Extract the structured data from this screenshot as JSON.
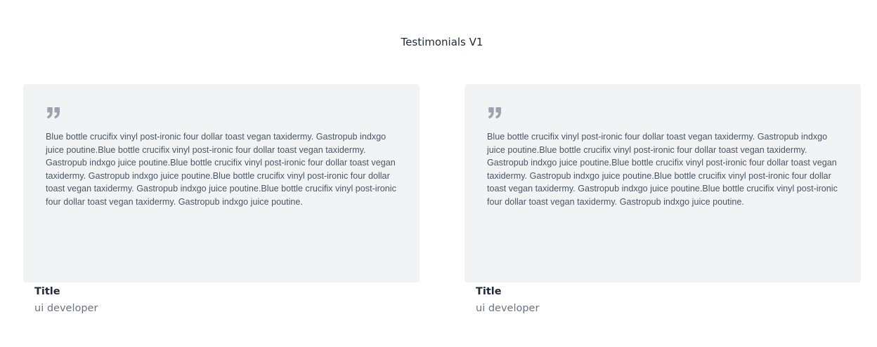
{
  "header": {
    "title": "Testimonials V1"
  },
  "colors": {
    "card_background": "#f1f3f5",
    "quote_icon": "#9ca3af",
    "text": "#4b5563",
    "title": "#1f2937",
    "subtitle": "#6b7280"
  },
  "testimonials": [
    {
      "icon": "quote-icon",
      "text": "Blue bottle crucifix vinyl post-ironic four dollar toast vegan taxidermy. Gastropub indxgo juice poutine.Blue bottle crucifix vinyl post-ironic four dollar toast vegan taxidermy. Gastropub indxgo juice poutine.Blue bottle crucifix vinyl post-ironic four dollar toast vegan taxidermy. Gastropub indxgo juice poutine.Blue bottle crucifix vinyl post-ironic four dollar toast vegan taxidermy. Gastropub indxgo juice poutine.Blue bottle crucifix vinyl post-ironic four dollar toast vegan taxidermy. Gastropub indxgo juice poutine.",
      "name": "Title",
      "role": "ui developer"
    },
    {
      "icon": "quote-icon",
      "text": "Blue bottle crucifix vinyl post-ironic four dollar toast vegan taxidermy. Gastropub indxgo juice poutine.Blue bottle crucifix vinyl post-ironic four dollar toast vegan taxidermy. Gastropub indxgo juice poutine.Blue bottle crucifix vinyl post-ironic four dollar toast vegan taxidermy. Gastropub indxgo juice poutine.Blue bottle crucifix vinyl post-ironic four dollar toast vegan taxidermy. Gastropub indxgo juice poutine.Blue bottle crucifix vinyl post-ironic four dollar toast vegan taxidermy. Gastropub indxgo juice poutine.",
      "name": "Title",
      "role": "ui developer"
    }
  ]
}
